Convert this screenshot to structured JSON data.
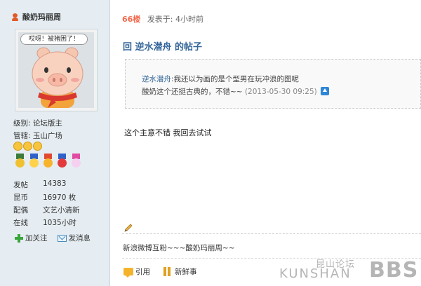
{
  "user": {
    "name": "酸奶玛丽周",
    "avatar_caption": "哎呀！被猪困了！",
    "level_label": "级别:",
    "level_value": "论坛版主",
    "manage_label": "管辖:",
    "manage_value": "玉山广场",
    "stats": [
      {
        "key": "发帖",
        "value": "14383"
      },
      {
        "key": "昆币",
        "value": "16970 枚"
      },
      {
        "key": "配偶",
        "value": "文艺小清新"
      },
      {
        "key": "在线",
        "value": "1035小时"
      }
    ],
    "follow_label": "加关注",
    "message_label": "发消息"
  },
  "post": {
    "floor": "66楼",
    "posted_at": "发表于: 4小时前",
    "title": "回 逆水潜舟 的帖子",
    "quote": {
      "author": "逆水潜舟",
      "line1_rest": ":我还以为画的是个型男在玩冲浪的图呢",
      "line2": "酸奶这个还挺古典的，不错~~",
      "time": "(2013-05-30 09:25)"
    },
    "reply_text": "这个主意不错 我回去试试",
    "signature": "新浪微博互粉~~~酸奶玛丽周~~"
  },
  "actions": {
    "quote_label": "引用",
    "news_label": "新鲜事"
  },
  "watermark": {
    "cn": "昆山论坛",
    "en": "KUNSHAN",
    "bbs": "BBS"
  },
  "colors": {
    "sidebar_bg": "#e5edf2",
    "link_blue": "#336699",
    "floor_orange": "#f26c4f"
  }
}
